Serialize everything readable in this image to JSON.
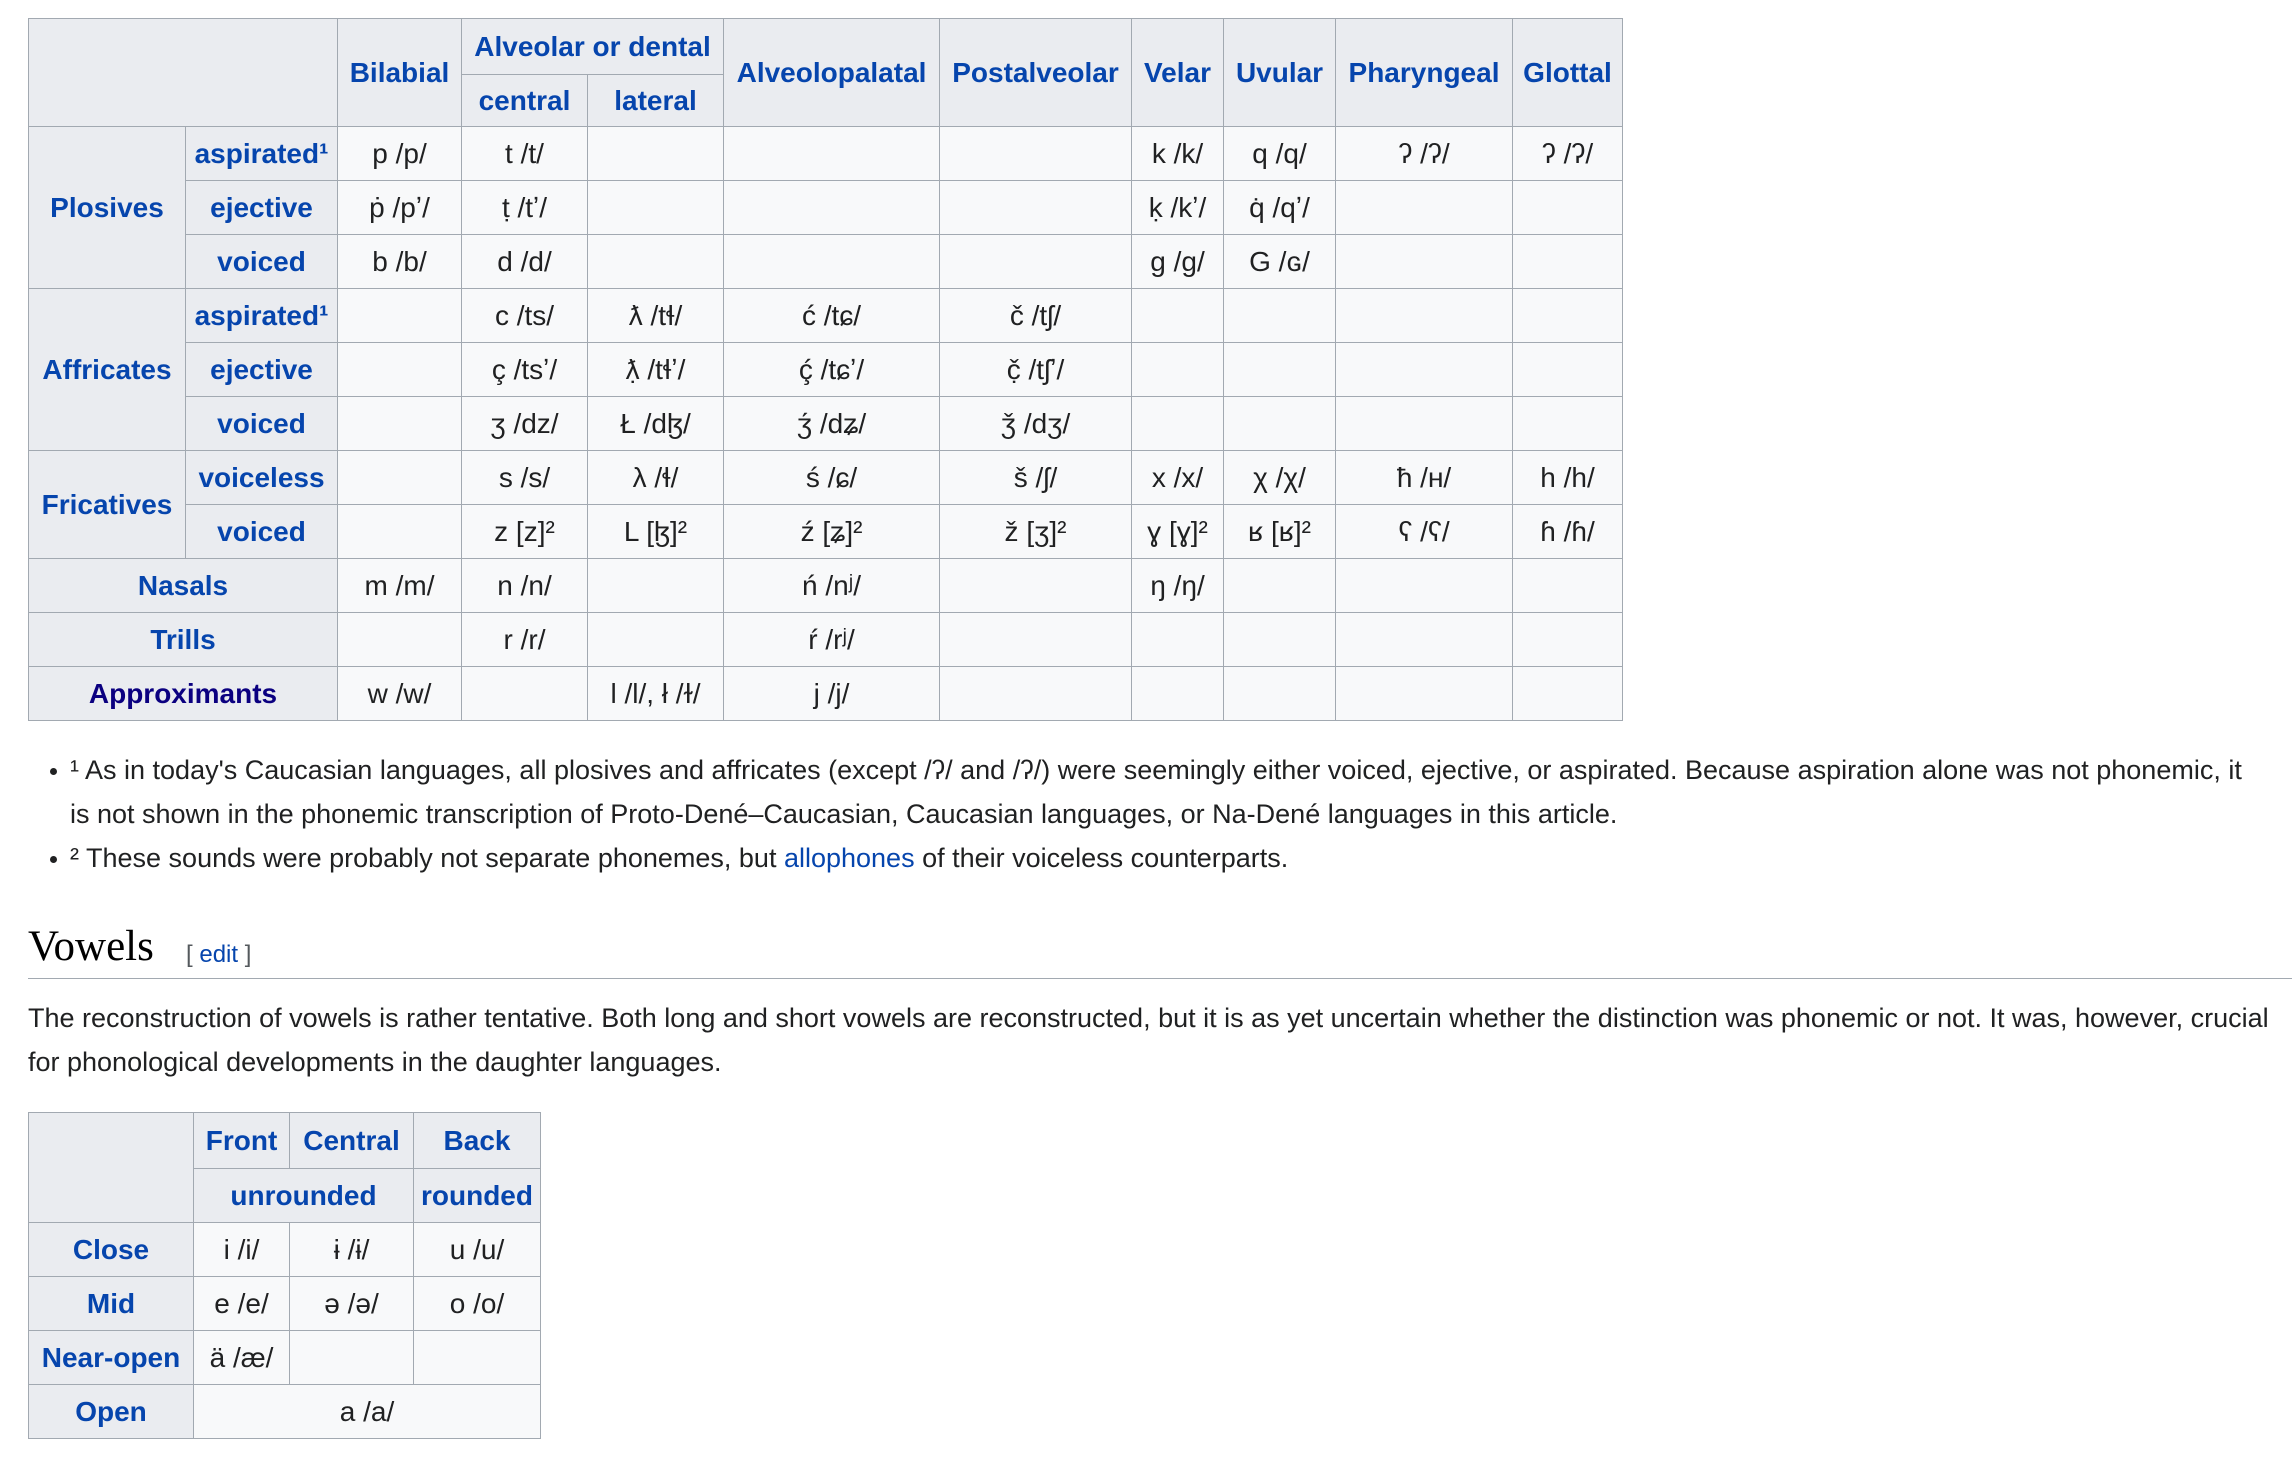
{
  "consonants": {
    "headers": {
      "bilabial": "Bilabial",
      "alveolar": "Alveolar or dental",
      "central": "central",
      "lateral": "lateral",
      "alveolopalatal": "Alveolopalatal",
      "postalveolar": "Postalveolar",
      "velar": "Velar",
      "uvular": "Uvular",
      "pharyngeal": "Pharyngeal",
      "glottal": "Glottal"
    },
    "groups": {
      "plosives": "Plosives",
      "affricates": "Affricates",
      "fricatives": "Fricatives",
      "nasals": "Nasals",
      "trills": "Trills",
      "approximants": "Approximants"
    },
    "subrows": {
      "aspirated": "aspirated¹",
      "ejective": "ejective",
      "voiced": "voiced",
      "voiceless": "voiceless"
    },
    "rows": {
      "plosives_aspirated": [
        "p /p/",
        "t /t/",
        "",
        "",
        "",
        "k /k/",
        "q /q/",
        "ʔ /ʔ/",
        "ʔ /ʔ/"
      ],
      "plosives_ejective": [
        "ṗ /pʼ/",
        "ṭ /tʼ/",
        "",
        "",
        "",
        "ḳ /kʼ/",
        "q̇ /qʼ/",
        "",
        ""
      ],
      "plosives_voiced": [
        "b /b/",
        "d /d/",
        "",
        "",
        "",
        "g /g/",
        "G /ɢ/",
        "",
        ""
      ],
      "affricates_aspirated": [
        "",
        "c /ts/",
        "ƛ /tɬ/",
        "ć /tɕ/",
        "č /tʃ/",
        "",
        "",
        "",
        ""
      ],
      "affricates_ejective": [
        "",
        "ç /tsʼ/",
        "ƛ̣ /tɬʼ/",
        "ḉ /tɕʼ/",
        "č̣ /tʃʼ/",
        "",
        "",
        "",
        ""
      ],
      "affricates_voiced": [
        "",
        "ʒ /dz/",
        "Ł /dɮ/",
        "ʒ́ /dʑ/",
        "ǯ /dʒ/",
        "",
        "",
        "",
        ""
      ],
      "fricatives_voiceless": [
        "",
        "s /s/",
        "λ /ɬ/",
        "ś /ɕ/",
        "š /ʃ/",
        "x /x/",
        "χ /χ/",
        "ħ /ʜ/",
        "h /h/"
      ],
      "fricatives_voiced": [
        "",
        "z [z]²",
        "L [ɮ]²",
        "ź [ʑ]²",
        "ž [ʒ]²",
        "ɣ [ɣ]²",
        "ʁ [ʁ]²",
        "ʕ /ʕ/",
        "ɦ /ɦ/"
      ],
      "nasals": [
        "m /m/",
        "n /n/",
        "",
        "ń /nʲ/",
        "",
        "ŋ /ŋ/",
        "",
        "",
        ""
      ],
      "trills": [
        "",
        "r /r/",
        "",
        "ŕ /rʲ/",
        "",
        "",
        "",
        "",
        ""
      ],
      "approximants": [
        "w /w/",
        "",
        "l /l/, ł /ɫ/",
        "j /j/",
        "",
        "",
        "",
        "",
        ""
      ]
    }
  },
  "footnotes": {
    "note1": "¹ As in today's Caucasian languages, all plosives and affricates (except /ʔ/ and /ʔ/) were seemingly either voiced, ejective, or aspirated. Because aspiration alone was not phonemic, it is not shown in the phonemic transcription of Proto-Dené–Caucasian, Caucasian languages, or Na-Dené languages in this article.",
    "note2_before": "² These sounds were probably not separate phonemes, but ",
    "note2_link": "allophones",
    "note2_after": " of their voiceless counterparts."
  },
  "vowels_section": {
    "title": "Vowels",
    "edit_open": "[ ",
    "edit_label": "edit",
    "edit_close": " ]",
    "intro": "The reconstruction of vowels is rather tentative. Both long and short vowels are reconstructed, but it is as yet uncertain whether the distinction was phonemic or not. It was, however, crucial for phonological developments in the daughter languages."
  },
  "vowels": {
    "headers": {
      "front": "Front",
      "central": "Central",
      "back": "Back",
      "unrounded": "unrounded",
      "rounded": "rounded"
    },
    "rows": {
      "close": {
        "label": "Close",
        "cells": [
          "i /i/",
          "ɨ /ɨ/",
          "u /u/"
        ]
      },
      "mid": {
        "label": "Mid",
        "cells": [
          "e /e/",
          "ə /ə/",
          "o /o/"
        ]
      },
      "near_open": {
        "label": "Near-open",
        "cells": [
          "ä /æ/",
          "",
          ""
        ]
      },
      "open": {
        "label": "Open",
        "cells": [
          "a /a/"
        ]
      }
    }
  },
  "colors": {
    "link": "#0645ad",
    "visited_link": "#0b0080",
    "header_bg": "#eaecf0",
    "cell_bg": "#f8f9fa",
    "border": "#a2a9b1"
  }
}
